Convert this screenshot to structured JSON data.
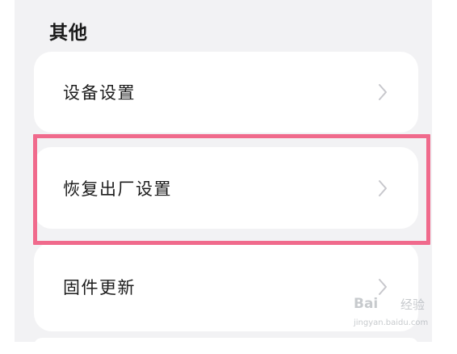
{
  "section": {
    "title": "其他"
  },
  "settings_items": [
    {
      "label": "设备设置"
    },
    {
      "label": "恢复出厂设置"
    },
    {
      "label": "固件更新"
    }
  ],
  "highlight": {
    "color": "#f06a8c",
    "target": "恢复出厂设置"
  },
  "watermark": {
    "brand": "Bai",
    "brand_suffix": "经验",
    "url": "jingyan.baidu.com"
  },
  "colors": {
    "background": "#f2f2f4",
    "card": "#ffffff",
    "text": "#1c1c1c",
    "chevron": "#c7c7cc"
  },
  "icons": {
    "chevron": "chevron-right-icon"
  }
}
